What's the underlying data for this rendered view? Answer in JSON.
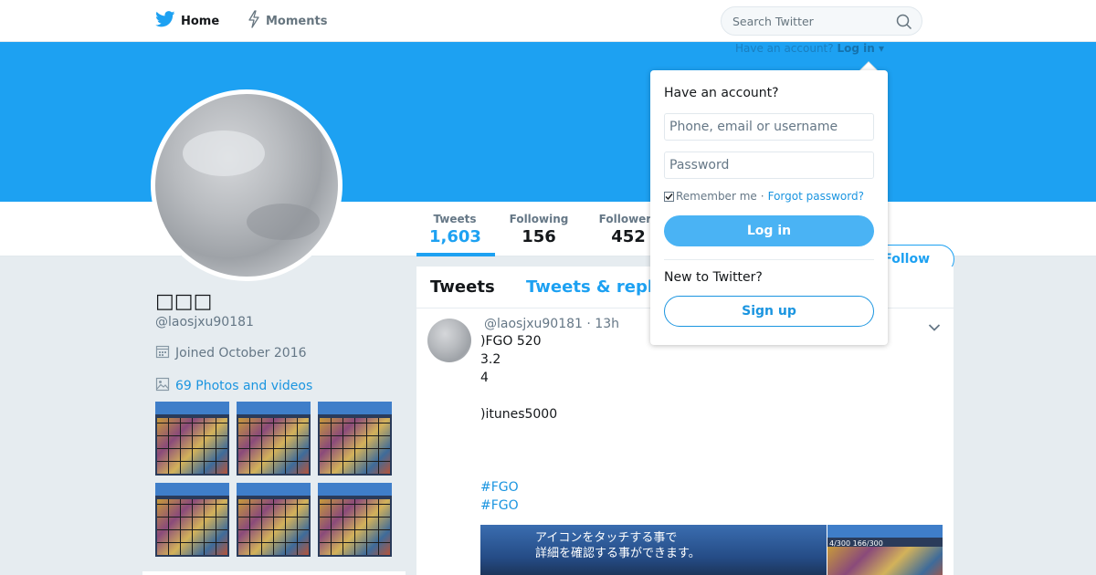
{
  "nav": {
    "home_label": "Home",
    "moments_label": "Moments",
    "search_placeholder": "Search Twitter"
  },
  "header": {
    "have_account": "Have an account?",
    "login_link": "Log in"
  },
  "profile": {
    "name": "□□□",
    "handle": "@laosjxu90181",
    "joined": "Joined October 2016",
    "photos_link": "69 Photos and videos",
    "stats": [
      {
        "label": "Tweets",
        "value": "1,603"
      },
      {
        "label": "Following",
        "value": "156"
      },
      {
        "label": "Followers",
        "value": "452"
      }
    ],
    "follow_label": "Follow"
  },
  "timeline": {
    "tabs": [
      "Tweets",
      "Tweets & replies"
    ],
    "tweet": {
      "handle": "@laosjxu90181",
      "time": "13h",
      "lines": [
        ")FGO 520",
        "3.2",
        "4",
        ")itunes5000"
      ],
      "hashtags": [
        "#FGO",
        "#FGO"
      ],
      "media_text_1": "アイコンをタッチする事で",
      "media_text_2": "詳細を確認する事ができます。",
      "media2_text": "4/300   166/300"
    }
  },
  "login_dropdown": {
    "title": "Have an account?",
    "username_placeholder": "Phone, email or username",
    "password_placeholder": "Password",
    "remember_me": "Remember me",
    "separator": "·",
    "forgot_password": "Forgot password?",
    "login_button": "Log in",
    "new_to_twitter": "New to Twitter?",
    "signup_button": "Sign up"
  },
  "colors": {
    "brand": "#1da1f2",
    "link": "#1b95e0",
    "text": "#14171a",
    "muted": "#657786"
  }
}
